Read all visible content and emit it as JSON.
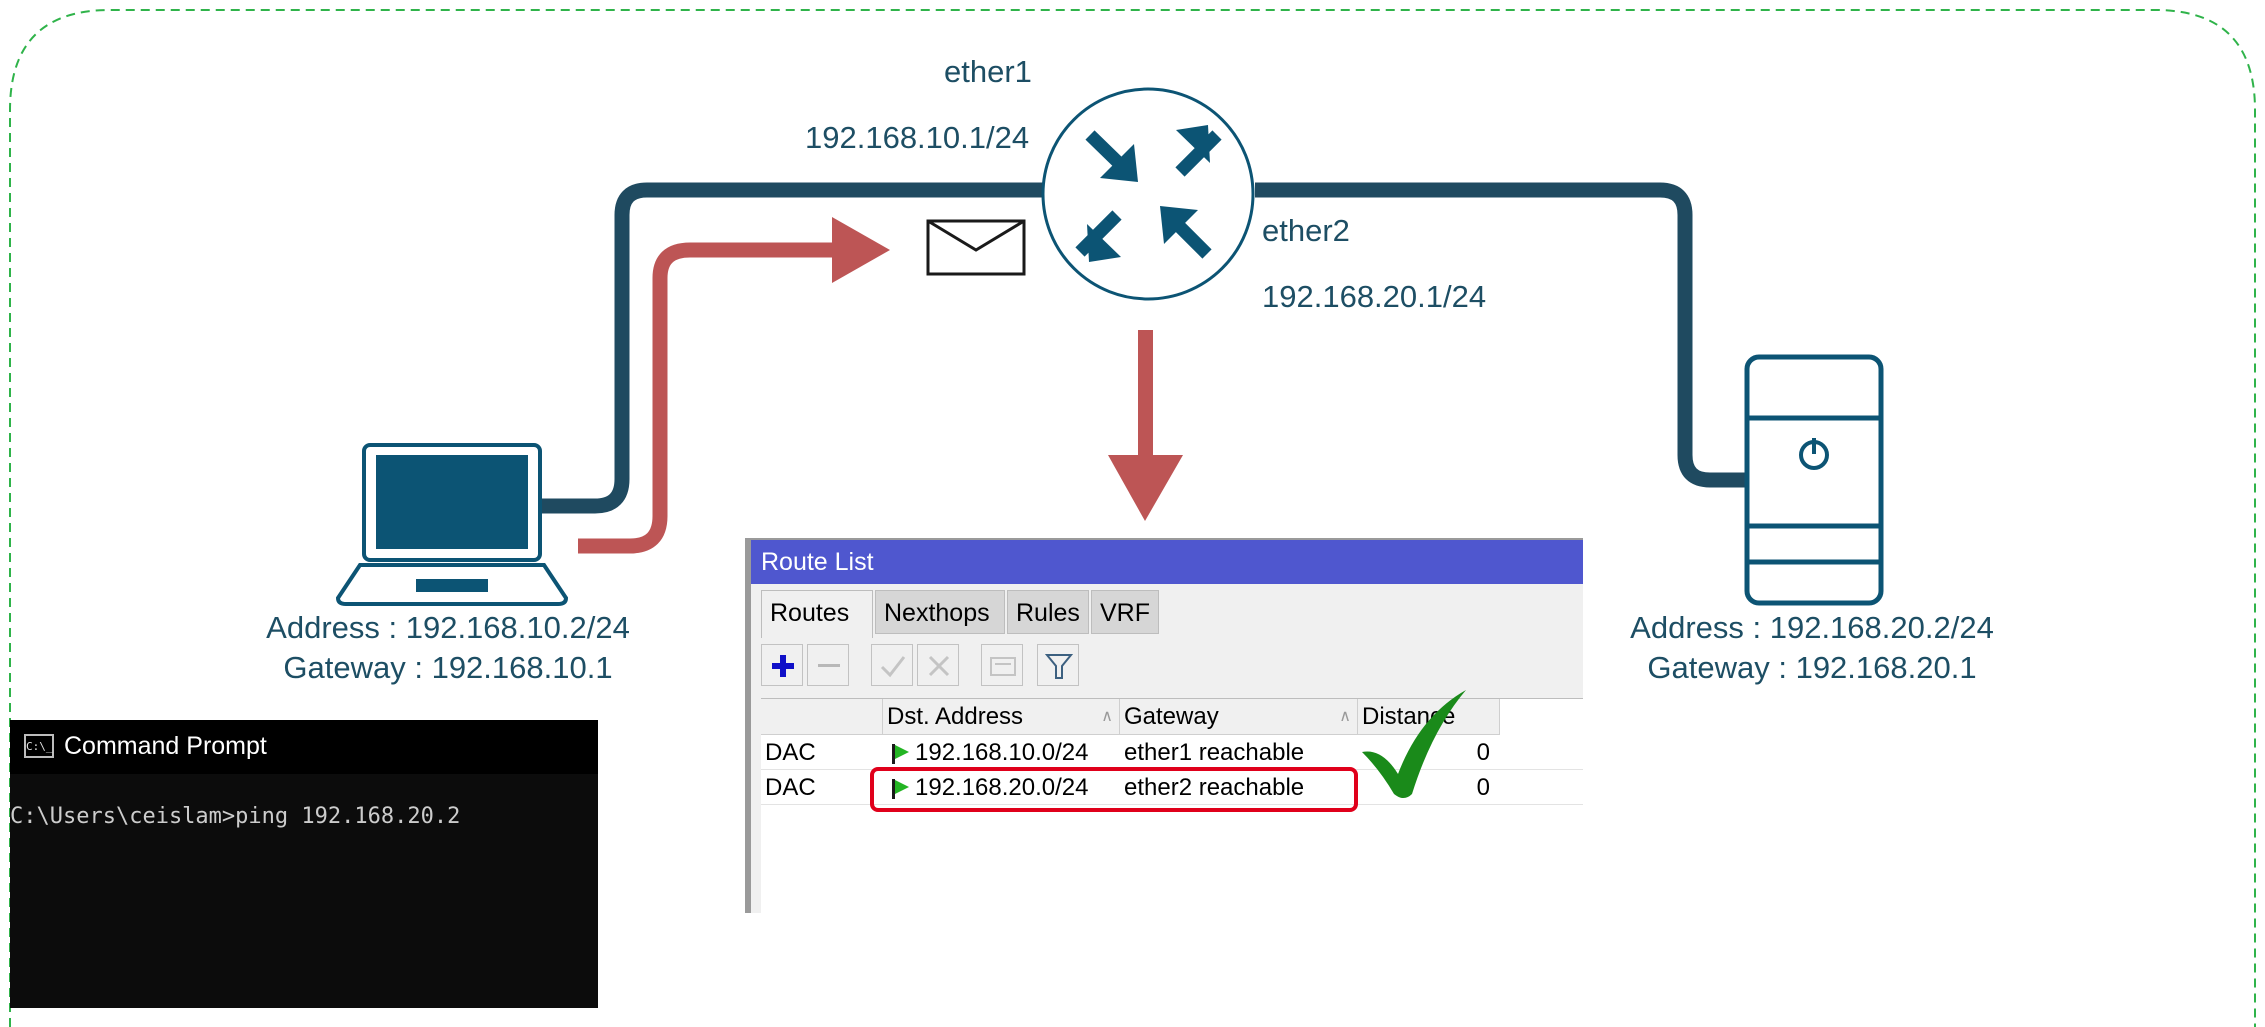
{
  "router": {
    "if1_name": "ether1",
    "if1_addr": "192.168.10.1/24",
    "if2_name": "ether2",
    "if2_addr": "192.168.20.1/24"
  },
  "laptop": {
    "address": "Address : 192.168.10.2/24",
    "gateway": "Gateway : 192.168.10.1"
  },
  "server": {
    "address": "Address : 192.168.20.2/24",
    "gateway": "Gateway : 192.168.20.1"
  },
  "cmd": {
    "title": "Command Prompt",
    "icon_text": "C:\\_",
    "line": "C:\\Users\\ceislam>ping 192.168.20.2"
  },
  "route_list": {
    "title": "Route List",
    "tabs": [
      "Routes",
      "Nexthops",
      "Rules",
      "VRF"
    ],
    "columns": [
      "",
      "Dst. Address",
      "Gateway",
      "Distance"
    ],
    "rows": [
      {
        "flags": "DAC",
        "dst": "192.168.10.0/24",
        "gateway": "ether1 reachable",
        "distance": "0"
      },
      {
        "flags": "DAC",
        "dst": "192.168.20.0/24",
        "gateway": "ether2 reachable",
        "distance": "0"
      }
    ]
  },
  "colors": {
    "link": "#1f4a60",
    "device": "#0c5474",
    "arrow": "#bd5555",
    "border": "#2fb34a",
    "check": "#1a8a1a",
    "highlight": "#e0001b",
    "titlebar": "#4f57cf"
  },
  "icons": [
    "laptop-icon",
    "router-icon",
    "envelope-icon",
    "server-icon",
    "checkmark-icon",
    "flag-icon",
    "plus-icon",
    "minus-icon",
    "check-icon",
    "cross-icon",
    "comment-icon",
    "filter-icon",
    "cmd-icon"
  ]
}
